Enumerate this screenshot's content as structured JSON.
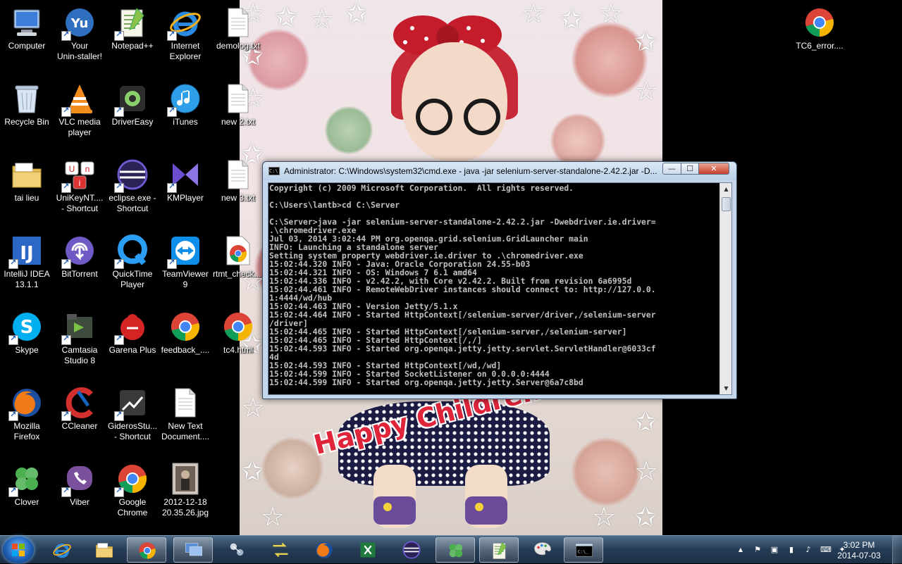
{
  "desktop": {
    "wallpaper_text": "Happy Children's",
    "icons": [
      {
        "label": "Computer",
        "icon": "computer-icon",
        "shortcut": false
      },
      {
        "label": "Your\nUnin-staller!",
        "icon": "uninstaller-icon",
        "shortcut": true
      },
      {
        "label": "Notepad++",
        "icon": "notepadpp-icon",
        "shortcut": true
      },
      {
        "label": "Internet\nExplorer",
        "icon": "ie-icon",
        "shortcut": true
      },
      {
        "label": "demolog.txt",
        "icon": "text-file-icon",
        "shortcut": false
      },
      {
        "label": "Recycle Bin",
        "icon": "recycle-bin-icon",
        "shortcut": false
      },
      {
        "label": "VLC media\nplayer",
        "icon": "vlc-icon",
        "shortcut": true
      },
      {
        "label": "DriverEasy",
        "icon": "drivereasy-icon",
        "shortcut": true
      },
      {
        "label": "iTunes",
        "icon": "itunes-icon",
        "shortcut": true
      },
      {
        "label": "new 2.txt",
        "icon": "text-file-icon",
        "shortcut": false
      },
      {
        "label": "tai lieu",
        "icon": "folder-icon",
        "shortcut": false
      },
      {
        "label": "UniKeyNT....\n- Shortcut",
        "icon": "unikey-icon",
        "shortcut": true
      },
      {
        "label": "eclipse.exe -\nShortcut",
        "icon": "eclipse-icon",
        "shortcut": true
      },
      {
        "label": "KMPlayer",
        "icon": "kmplayer-icon",
        "shortcut": true
      },
      {
        "label": "new 3.txt",
        "icon": "text-file-icon",
        "shortcut": false
      },
      {
        "label": "IntelliJ IDEA\n13.1.1",
        "icon": "intellij-icon",
        "shortcut": true
      },
      {
        "label": "BitTorrent",
        "icon": "bittorrent-icon",
        "shortcut": true
      },
      {
        "label": "QuickTime\nPlayer",
        "icon": "quicktime-icon",
        "shortcut": true
      },
      {
        "label": "TeamViewer\n9",
        "icon": "teamviewer-icon",
        "shortcut": true
      },
      {
        "label": "rtmt_check....",
        "icon": "chrome-html-icon",
        "shortcut": false
      },
      {
        "label": "Skype",
        "icon": "skype-icon",
        "shortcut": true
      },
      {
        "label": "Camtasia\nStudio 8",
        "icon": "camtasia-icon",
        "shortcut": true
      },
      {
        "label": "Garena Plus",
        "icon": "garena-icon",
        "shortcut": true
      },
      {
        "label": "feedback_....",
        "icon": "chrome-icon",
        "shortcut": false
      },
      {
        "label": "tc4.html",
        "icon": "chrome-icon",
        "shortcut": false
      },
      {
        "label": "Mozilla\nFirefox",
        "icon": "firefox-icon",
        "shortcut": true
      },
      {
        "label": "CCleaner",
        "icon": "ccleaner-icon",
        "shortcut": true
      },
      {
        "label": "GiderosStu...\n- Shortcut",
        "icon": "gideros-icon",
        "shortcut": true
      },
      {
        "label": "New Text\nDocument....",
        "icon": "text-file-icon",
        "shortcut": false
      },
      {
        "label": "Clover",
        "icon": "clover-icon",
        "shortcut": true
      },
      {
        "label": "Viber",
        "icon": "viber-icon",
        "shortcut": true
      },
      {
        "label": "Google\nChrome",
        "icon": "chrome-icon",
        "shortcut": true
      },
      {
        "label": "2012-12-18\n20.35.26.jpg",
        "icon": "photo-thumbnail-icon",
        "shortcut": false
      },
      {
        "label": "TC6_error....",
        "icon": "chrome-icon",
        "shortcut": false
      }
    ]
  },
  "cmd_window": {
    "title": "Administrator: C:\\Windows\\system32\\cmd.exe - java  -jar selenium-server-standalone-2.42.2.jar -D...",
    "minimize_label": "—",
    "maximize_label": "☐",
    "close_label": "✕",
    "scroll_up": "▲",
    "scroll_down": "▼",
    "lines": [
      "Copyright (c) 2009 Microsoft Corporation.  All rights reserved.",
      "",
      "C:\\Users\\lantb>cd C:\\Server",
      "",
      "C:\\Server>java -jar selenium-server-standalone-2.42.2.jar -Dwebdriver.ie.driver=",
      ".\\chromedriver.exe",
      "Jul 03, 2014 3:02:44 PM org.openqa.grid.selenium.GridLauncher main",
      "INFO: Launching a standalone server",
      "Setting system property webdriver.ie.driver to .\\chromedriver.exe",
      "15:02:44.320 INFO - Java: Oracle Corporation 24.55-b03",
      "15:02:44.321 INFO - OS: Windows 7 6.1 amd64",
      "15:02:44.336 INFO - v2.42.2, with Core v2.42.2. Built from revision 6a6995d",
      "15:02:44.461 INFO - RemoteWebDriver instances should connect to: http://127.0.0.",
      "1:4444/wd/hub",
      "15:02:44.463 INFO - Version Jetty/5.1.x",
      "15:02:44.464 INFO - Started HttpContext[/selenium-server/driver,/selenium-server",
      "/driver]",
      "15:02:44.465 INFO - Started HttpContext[/selenium-server,/selenium-server]",
      "15:02:44.465 INFO - Started HttpContext[/,/]",
      "15:02:44.593 INFO - Started org.openqa.jetty.jetty.servlet.ServletHandler@6033cf",
      "4d",
      "15:02:44.593 INFO - Started HttpContext[/wd,/wd]",
      "15:02:44.599 INFO - Started SocketListener on 0.0.0.0:4444",
      "15:02:44.599 INFO - Started org.openqa.jetty.jetty.Server@6a7c8bd",
      "_"
    ]
  },
  "taskbar": {
    "pinned": [
      {
        "name": "taskbar-ie",
        "icon": "ie-icon",
        "active": false
      },
      {
        "name": "taskbar-explorer",
        "icon": "folder-icon",
        "active": false
      },
      {
        "name": "taskbar-chrome",
        "icon": "chrome-icon",
        "active": true
      },
      {
        "name": "taskbar-remote-desktop",
        "icon": "remote-desktop-icon",
        "active": true
      },
      {
        "name": "taskbar-network-app",
        "icon": "network-icon",
        "active": false
      },
      {
        "name": "taskbar-network-transfer",
        "icon": "transfer-icon",
        "active": false
      },
      {
        "name": "taskbar-firefox",
        "icon": "firefox-icon",
        "active": false
      },
      {
        "name": "taskbar-excel",
        "icon": "excel-icon",
        "active": false
      },
      {
        "name": "taskbar-eclipse",
        "icon": "eclipse-icon",
        "active": false
      },
      {
        "name": "taskbar-clover",
        "icon": "clover-icon",
        "active": true
      },
      {
        "name": "taskbar-notepadpp",
        "icon": "notepadpp-icon",
        "active": true
      },
      {
        "name": "taskbar-paint",
        "icon": "paint-icon",
        "active": false
      },
      {
        "name": "taskbar-cmd",
        "icon": "cmd-icon",
        "active": true
      }
    ],
    "tray_icons": [
      "show-hidden-icon",
      "security-icon",
      "usb-icon",
      "signal-icon",
      "speaker-icon",
      "input-icon",
      "dropbox-icon"
    ],
    "clock_time": "3:02 PM",
    "clock_date": "2014-07-03",
    "cmd_glyph": "C:\\_"
  }
}
